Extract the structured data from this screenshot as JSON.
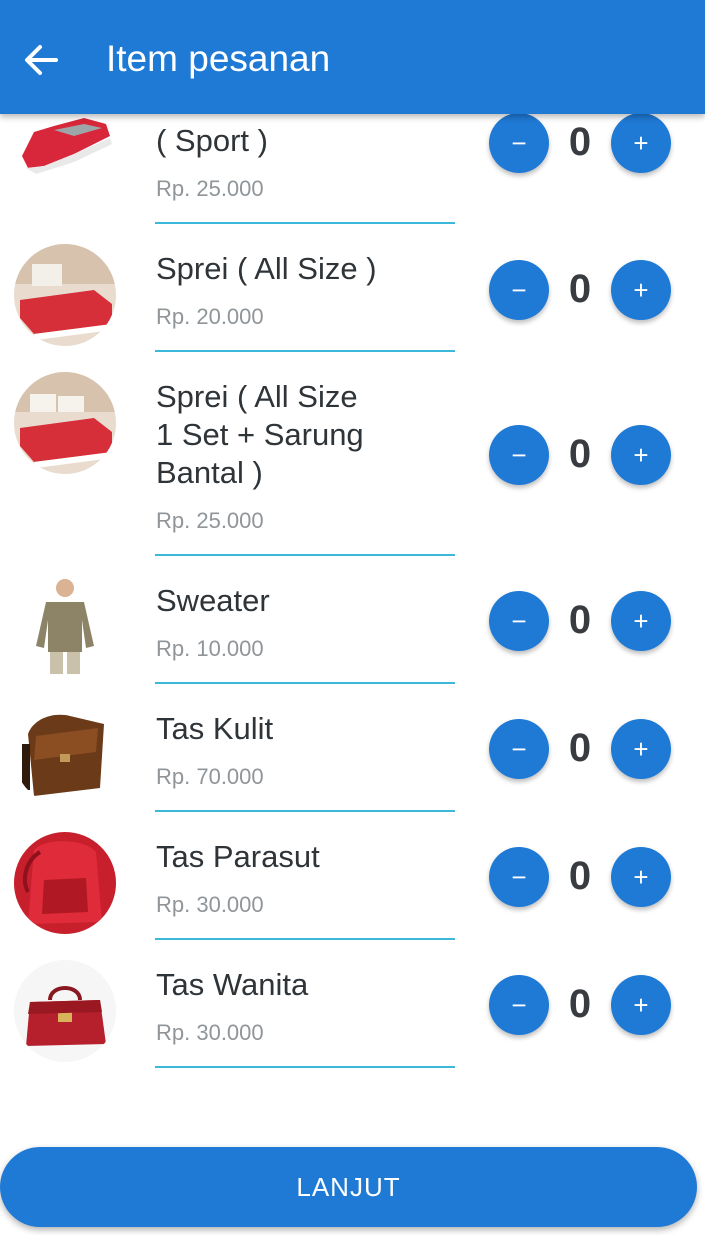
{
  "appbar": {
    "title": "Item pesanan",
    "back_icon": "arrow-left-icon"
  },
  "colors": {
    "primary": "#1f7ad6",
    "divider": "#3cb9d9",
    "price": "#8f9599"
  },
  "items": [
    {
      "name": "( Sport )",
      "price": "Rp. 25.000",
      "qty": "0",
      "image": "red-sport-shoe"
    },
    {
      "name": "Sprei (  All Size )",
      "price": "Rp. 20.000",
      "qty": "0",
      "image": "red-bedsheet"
    },
    {
      "name": "Sprei (  All Size\n1 Set + Sarung\nBantal  )",
      "price": "Rp. 25.000",
      "qty": "0",
      "image": "red-bedsheet-set"
    },
    {
      "name": "Sweater",
      "price": "Rp. 10.000",
      "qty": "0",
      "image": "man-in-sweater"
    },
    {
      "name": "Tas Kulit",
      "price": "Rp. 70.000",
      "qty": "0",
      "image": "brown-leather-bag"
    },
    {
      "name": "Tas Parasut",
      "price": "Rp. 30.000",
      "qty": "0",
      "image": "red-backpack"
    },
    {
      "name": "Tas Wanita",
      "price": "Rp. 30.000",
      "qty": "0",
      "image": "red-handbag"
    }
  ],
  "stepper": {
    "minus": "−",
    "plus": "+"
  },
  "footer": {
    "button_label": "LANJUT"
  }
}
